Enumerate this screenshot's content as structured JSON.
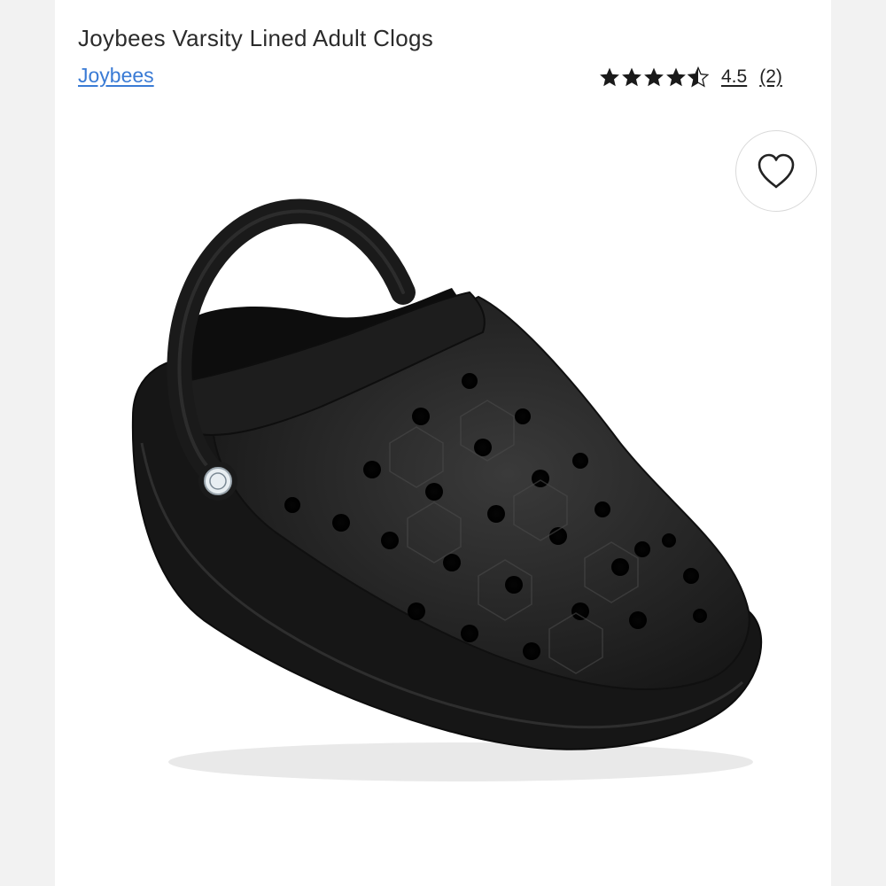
{
  "product": {
    "title": "Joybees Varsity Lined Adult Clogs",
    "brand": "Joybees",
    "image_alt": "Black lined clog with back strap"
  },
  "rating": {
    "value": "4.5",
    "count": "(2)",
    "stars_filled": 4.5,
    "stars_total": 5,
    "star_color": "#1a1a1a"
  },
  "actions": {
    "favorite_icon": "heart-outline-icon"
  },
  "colors": {
    "brand_link": "#3a7bd5",
    "title_text": "#2b2b2b",
    "page_background": "#f2f2f2",
    "card_background": "#ffffff"
  }
}
